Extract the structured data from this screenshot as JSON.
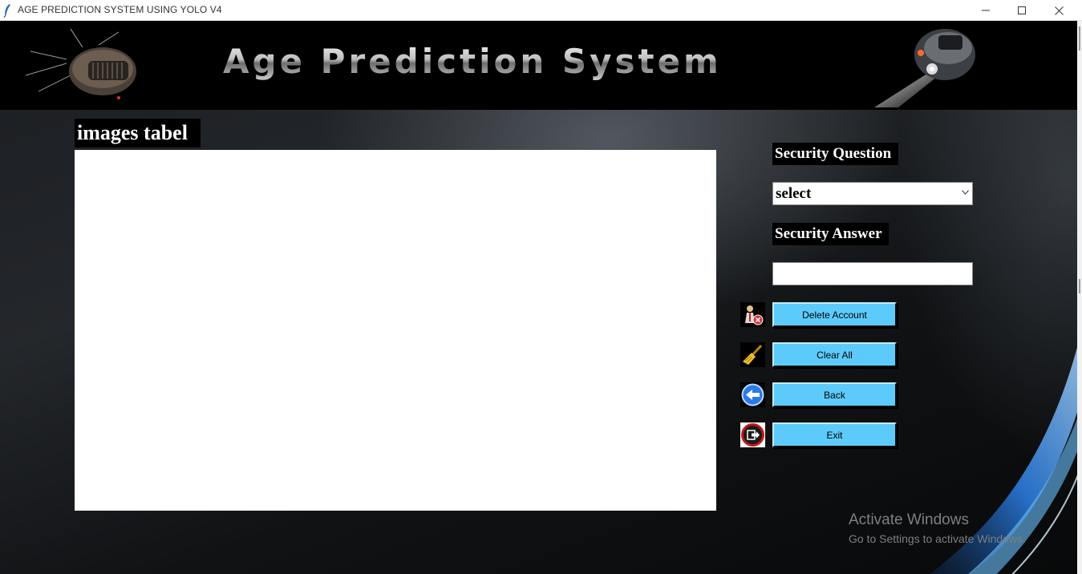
{
  "window": {
    "title": "AGE PREDICTION SYSTEM USING YOLO V4"
  },
  "banner": {
    "title": "Age Prediction System"
  },
  "images_table": {
    "label": "images tabel"
  },
  "security_question": {
    "label": "Security Question",
    "selected": "select"
  },
  "security_answer": {
    "label": "Security Answer",
    "value": ""
  },
  "buttons": {
    "delete_account": "Delete Account",
    "clear_all": "Clear All",
    "back": "Back",
    "exit": "Exit"
  },
  "watermark": {
    "line1": "Activate Windows",
    "line2": "Go to Settings to activate Windows."
  },
  "colors": {
    "button": "#5ccbfb",
    "label_bg": "#000000",
    "accent_swoosh": "#3aa0ff"
  }
}
